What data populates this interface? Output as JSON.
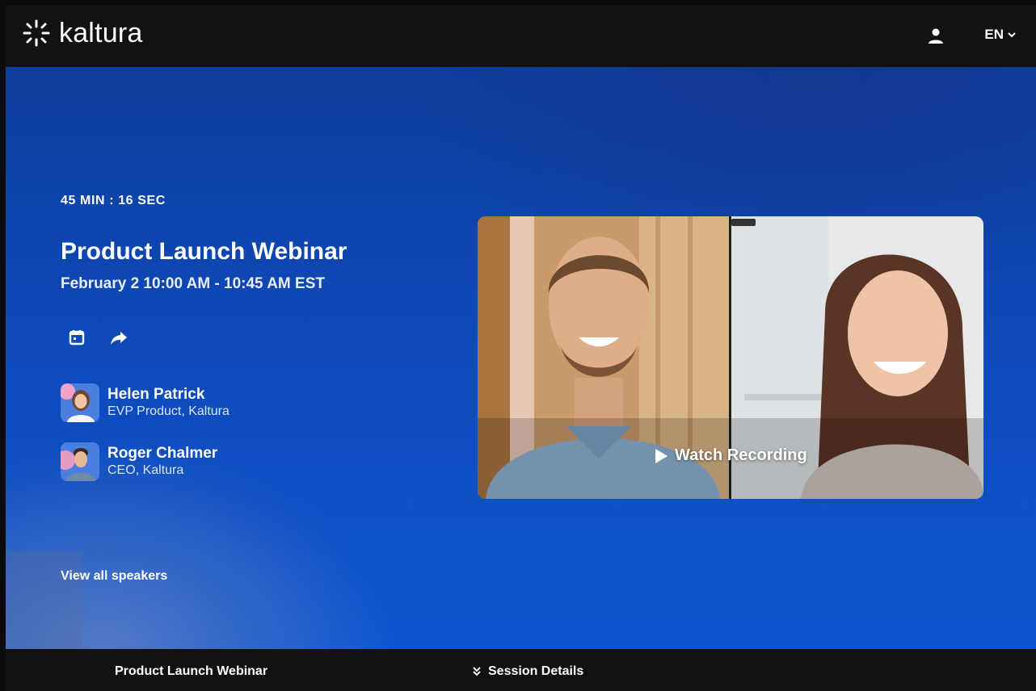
{
  "header": {
    "logo_text": "kaltura",
    "language": "EN"
  },
  "event": {
    "timer": "45 MIN : 16 SEC",
    "title": "Product Launch Webinar",
    "datetime": "February 2  10:00 AM - 10:45 AM EST"
  },
  "speakers": [
    {
      "name": "Helen Patrick",
      "role": "EVP Product, Kaltura"
    },
    {
      "name": "Roger Chalmer",
      "role": "CEO, Kaltura"
    }
  ],
  "view_all_label": "View all speakers",
  "video": {
    "cta": "Watch Recording"
  },
  "footer": {
    "title": "Product Launch Webinar",
    "session_details": "Session Details"
  },
  "colors": {
    "hero_blue": "#0e49b8",
    "header_bg": "#121212",
    "text": "#ffffff"
  }
}
